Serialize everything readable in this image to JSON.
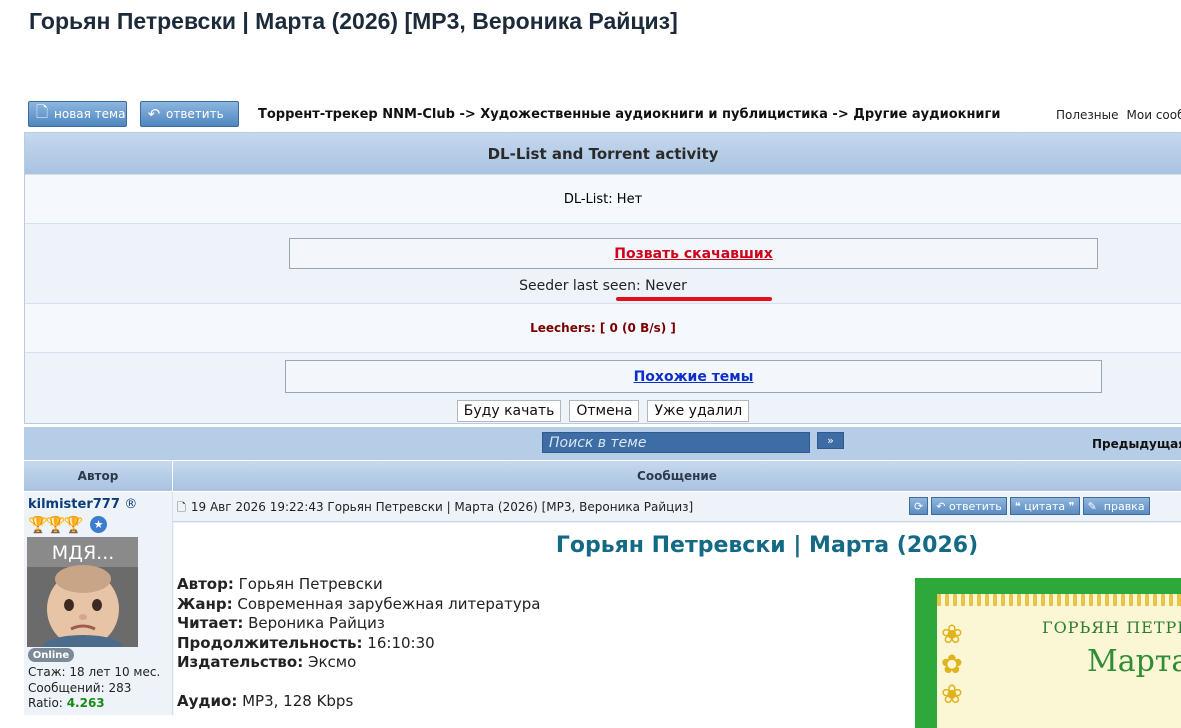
{
  "page": {
    "title": "Горьян Петревски | Марта (2026) [MP3, Вероника Райциз]"
  },
  "toolbar": {
    "new_topic_label": "новая тема",
    "reply_label": "ответить",
    "breadcrumb": "Торрент-трекер NNM-Club -> Художественные аудиокниги и публицистика -> Другие аудиокниги",
    "links": [
      "Полезные",
      "Мои сообще"
    ]
  },
  "dl": {
    "header": "DL-List and Torrent activity",
    "dl_list": "DL-List: Нет",
    "call_downloaders": "Позвать скачавших",
    "seeder_last_seen": "Seeder last seen: Never",
    "leechers": "Leechers: [ 0  (0 B/s) ]",
    "similar_topics": "Похожие темы",
    "buttons": [
      "Буду качать",
      "Отмена",
      "Уже удалил"
    ]
  },
  "search": {
    "placeholder": "Поиск в теме",
    "go": "»",
    "prev": "Предыдущая"
  },
  "posts_header": {
    "author": "Автор",
    "message": "Сообщение"
  },
  "author": {
    "username": "kilmister777",
    "reg_mark": "®",
    "avatar_caption": "МДЯ...",
    "online": "Online",
    "tenure": "Стаж: 18 лет 10 мес.",
    "messages": "Сообщений: 283",
    "ratio_label": "Ratio:",
    "ratio_value": "4.263"
  },
  "post": {
    "meta": "19 Авг 2026 19:22:43  Горьян Петревски | Марта (2026) [MP3, Вероника Райциз]",
    "buttons": {
      "reply": "ответить",
      "quote": "цитата",
      "edit": "правка"
    },
    "title": "Горьян Петревски | Марта (2026)",
    "info": [
      {
        "label": "Автор:",
        "value": "Горьян Петревски"
      },
      {
        "label": "Жанр:",
        "value": "Современная зарубежная литература"
      },
      {
        "label": "Читает:",
        "value": "Вероника Райциз"
      },
      {
        "label": "Продолжительность:",
        "value": "16:10:30"
      },
      {
        "label": "Издательство:",
        "value": "Эксмо"
      },
      {
        "label": "Аудио:",
        "value": "MP3, 128 Kbps"
      }
    ],
    "cover_author": "ГОРЬЯН ПЕТРЕ",
    "cover_title": "Марта"
  },
  "colors": {
    "header_blue": "#a9c3e0",
    "link_red": "#d0021b",
    "link_blue": "#0d2fc9",
    "title_teal": "#146a84",
    "ratio_green": "#178a17"
  }
}
